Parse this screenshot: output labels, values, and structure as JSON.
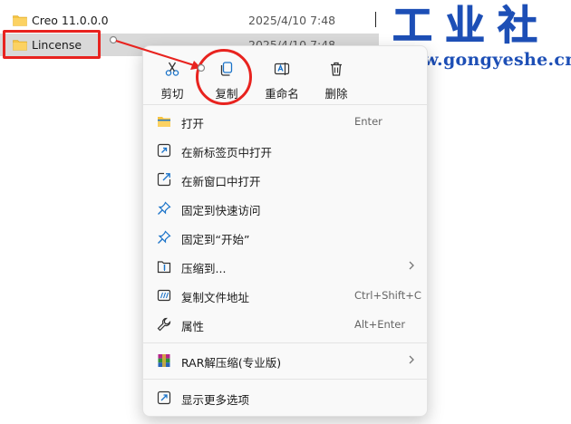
{
  "files": [
    {
      "name": "Creo 11.0.0.0",
      "date": "2025/4/10 7:48"
    },
    {
      "name": "Lincense",
      "date": "2025/4/10 7:48"
    }
  ],
  "watermark": {
    "title": "工业社",
    "url": "www.gongyeshe.cn"
  },
  "quick_actions": [
    {
      "label": "剪切",
      "icon": "scissors-icon"
    },
    {
      "label": "复制",
      "icon": "copy-icon"
    },
    {
      "label": "重命名",
      "icon": "rename-icon"
    },
    {
      "label": "删除",
      "icon": "trash-icon"
    }
  ],
  "menu_items": [
    {
      "label": "打开",
      "shortcut": "Enter",
      "icon": "folder-open-icon"
    },
    {
      "label": "在新标签页中打开",
      "shortcut": "",
      "icon": "new-tab-icon"
    },
    {
      "label": "在新窗口中打开",
      "shortcut": "",
      "icon": "new-window-icon"
    },
    {
      "label": "固定到快速访问",
      "shortcut": "",
      "icon": "pin-icon"
    },
    {
      "label": "固定到“开始”",
      "shortcut": "",
      "icon": "pin-start-icon"
    },
    {
      "label": "压缩到...",
      "shortcut": "",
      "icon": "zip-icon",
      "submenu": true
    },
    {
      "label": "复制文件地址",
      "shortcut": "Ctrl+Shift+C",
      "icon": "copy-path-icon"
    },
    {
      "label": "属性",
      "shortcut": "Alt+Enter",
      "icon": "wrench-icon"
    },
    {
      "label": "RAR解压缩(专业版)",
      "shortcut": "",
      "icon": "rar-icon",
      "submenu": true
    },
    {
      "label": "显示更多选项",
      "shortcut": "",
      "icon": "more-options-icon"
    }
  ],
  "colors": {
    "annotation": "#e8231f",
    "watermark": "#1d4fb6",
    "accent": "#1a73c9",
    "folder": "#f5c342"
  }
}
